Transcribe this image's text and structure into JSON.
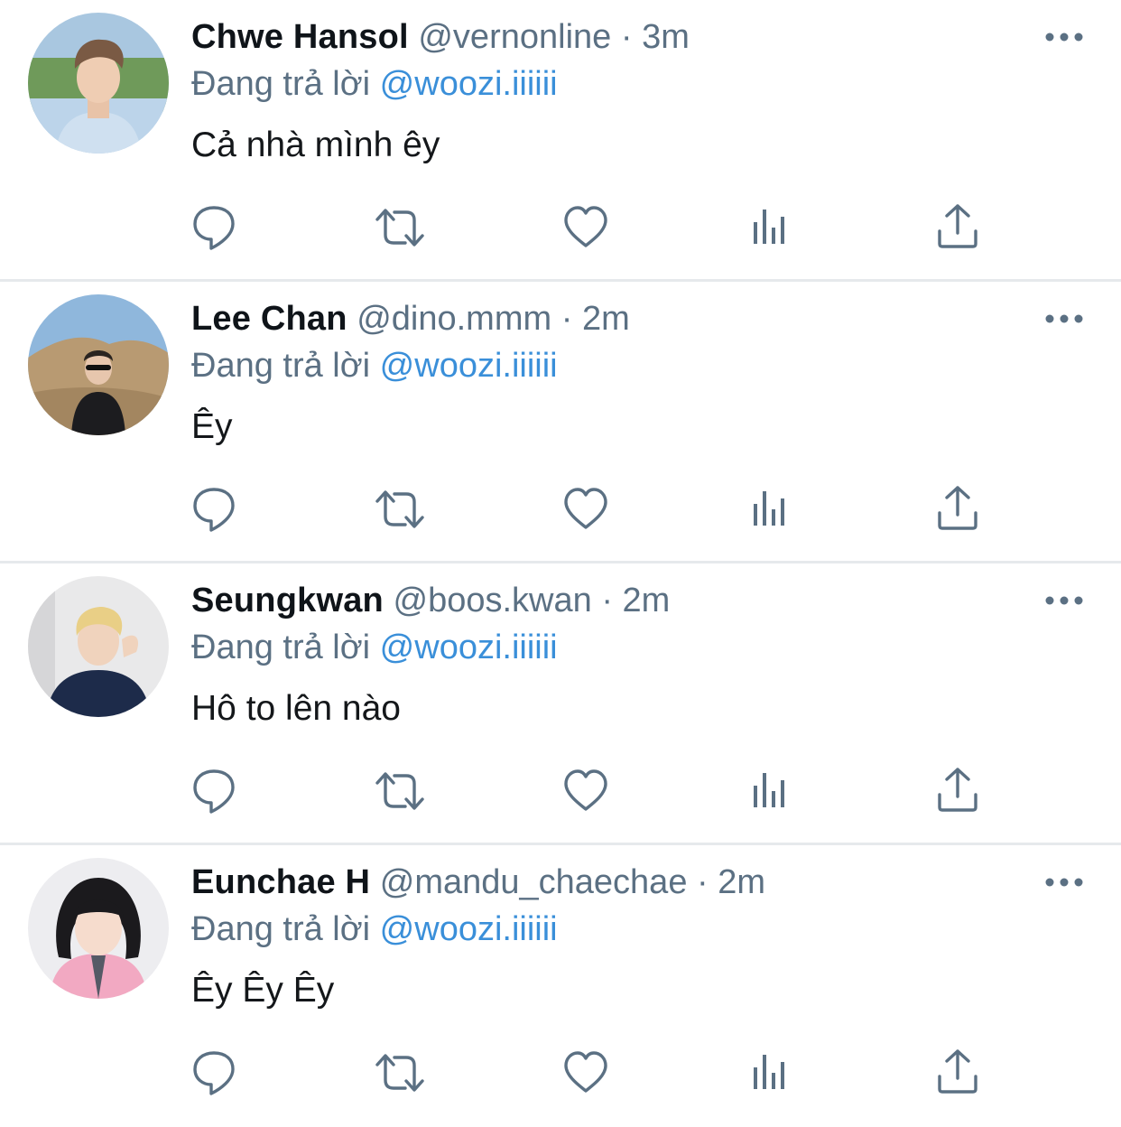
{
  "tweets": [
    {
      "name": "Chwe Hansol",
      "handle": "@vernonline",
      "separator": "·",
      "time": "3m",
      "replying_label": "Đang trả lời",
      "replying_to": "@woozi.iiiiii",
      "text": "Cả nhà mình êy"
    },
    {
      "name": "Lee Chan",
      "handle": "@dino.mmm",
      "separator": "·",
      "time": "2m",
      "replying_label": "Đang trả lời",
      "replying_to": "@woozi.iiiiii",
      "text": "Êy"
    },
    {
      "name": "Seungkwan",
      "handle": "@boos.kwan",
      "separator": "·",
      "time": "2m",
      "replying_label": "Đang trả lời",
      "replying_to": "@woozi.iiiiii",
      "text": "Hô to lên nào"
    },
    {
      "name": "Eunchae H",
      "handle": "@mandu_chaechae",
      "separator": "·",
      "time": "2m",
      "replying_label": "Đang trả lời",
      "replying_to": "@woozi.iiiiii",
      "text": "Êy Êy Êy"
    }
  ],
  "icons": {
    "reply": "reply-icon",
    "retweet": "retweet-icon",
    "like": "heart-icon",
    "analytics": "analytics-icon",
    "share": "share-icon",
    "more": "more-icon"
  },
  "colors": {
    "name": "#0f1419",
    "secondary": "#5b7083",
    "mention": "#3a8fd9",
    "icon": "#5b7083",
    "divider": "#e6e9ec"
  }
}
